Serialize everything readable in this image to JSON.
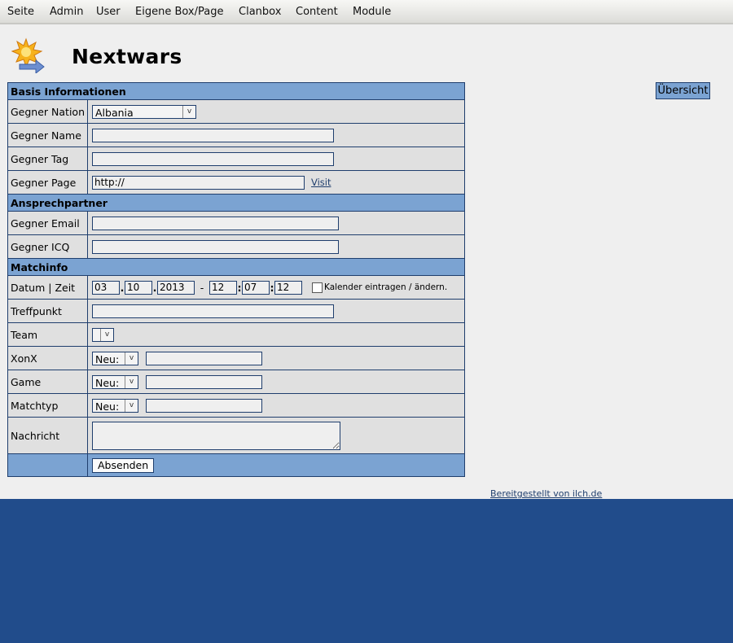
{
  "menu": [
    "Seite",
    "Admin",
    "User",
    "Eigene Box/Page",
    "Clanbox",
    "Content",
    "Module"
  ],
  "page": {
    "title": "Nextwars",
    "overview_button": "Übersicht",
    "credit_link": "Bereitgestellt von ilch.de",
    "logo_icon": "star-arrow-icon"
  },
  "form": {
    "sections": {
      "basis": "Basis Informationen",
      "contact": "Ansprechpartner",
      "match": "Matchinfo"
    },
    "labels": {
      "nation": "Gegner Nation",
      "name": "Gegner Name",
      "tag": "Gegner Tag",
      "page": "Gegner Page",
      "email": "Gegner Email",
      "icq": "Gegner ICQ",
      "datetime": "Datum | Zeit",
      "meeting": "Treffpunkt",
      "team": "Team",
      "xonx": "XonX",
      "game": "Game",
      "matchtype": "Matchtyp",
      "message": "Nachricht"
    },
    "values": {
      "nation": "Albania",
      "name": "",
      "tag": "",
      "page": "http://",
      "email": "",
      "icq": "",
      "day": "03",
      "month": "10",
      "year": "2013",
      "hour": "12",
      "minute": "07",
      "second": "12",
      "meeting": "",
      "team": "",
      "xonx_select": "Neu:",
      "xonx_text": "",
      "game_select": "Neu:",
      "game_text": "",
      "matchtype_select": "Neu:",
      "matchtype_text": "",
      "message": ""
    },
    "visit_link": "Visit",
    "calendar_label": "Kalender eintragen / ändern.",
    "date_sep": ".",
    "time_sep": ":",
    "range_sep": "-",
    "submit_label": "Absenden"
  },
  "colors": {
    "page_background": "#efefef",
    "outer_background": "#214c8b",
    "header_blue": "#7ba3d2",
    "border": "#1f3e6d",
    "row_background": "#e0e0e0"
  }
}
